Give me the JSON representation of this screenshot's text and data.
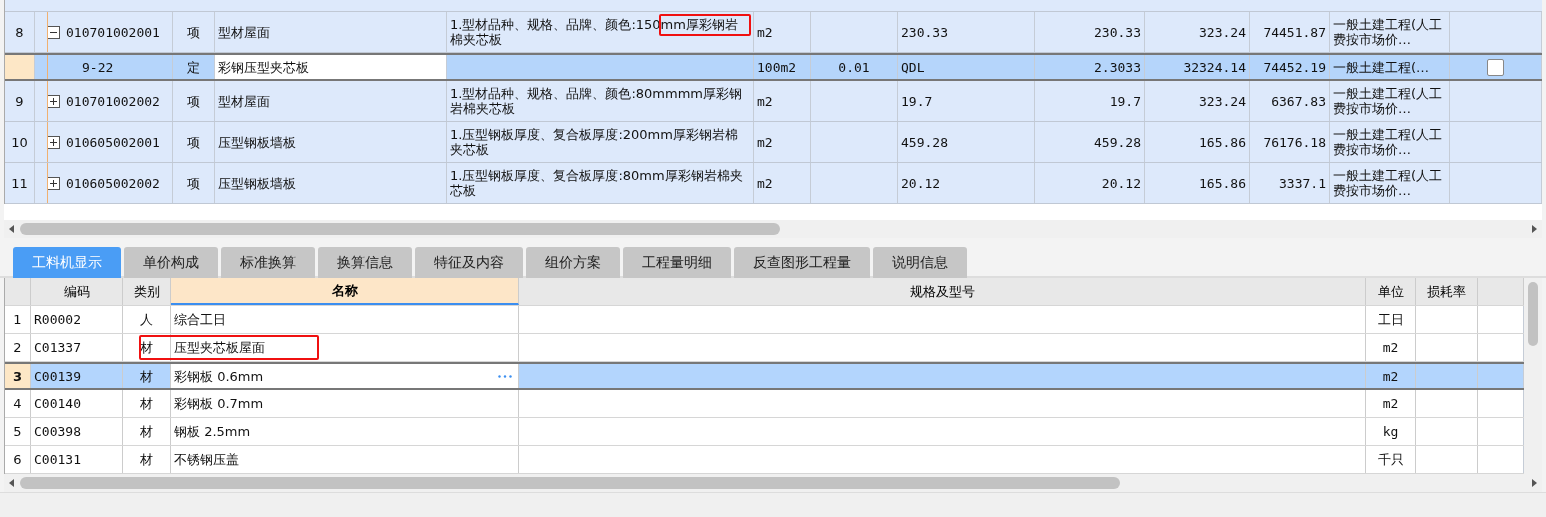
{
  "bill_rows": [
    {
      "kind": "item",
      "index": "8",
      "code": "010701002001",
      "expanded": true,
      "type": "项",
      "name": "型材屋面",
      "description": "1.型材品种、规格、品牌、颜色:150mm厚彩钢岩棉夹芯板",
      "marked": true,
      "unit": "m2",
      "column_7": "",
      "quantity_expression": "230.33",
      "quantity": "230.33",
      "unit_price": "323.24",
      "total": "74451.87",
      "fee_category": "一般土建工程(人工费按市场价…"
    },
    {
      "kind": "definition",
      "index": "",
      "code": "9-22",
      "type": "定",
      "name": "彩钢压型夹芯板",
      "description": "",
      "unit": "100m2",
      "column_7": "0.01",
      "quantity_expression": "QDL",
      "quantity": "2.3033",
      "unit_price": "32324.14",
      "total": "74452.19",
      "fee_category": "一般土建工程(…",
      "checked": false,
      "selected": true
    },
    {
      "kind": "item",
      "index": "9",
      "code": "010701002002",
      "expanded": false,
      "type": "项",
      "name": "型材屋面",
      "description": "1.型材品种、规格、品牌、颜色:80mmmm厚彩钢岩棉夹芯板",
      "marked": false,
      "unit": "m2",
      "column_7": "",
      "quantity_expression": "19.7",
      "quantity": "19.7",
      "unit_price": "323.24",
      "total": "6367.83",
      "fee_category": "一般土建工程(人工费按市场价…"
    },
    {
      "kind": "item",
      "index": "10",
      "code": "010605002001",
      "expanded": false,
      "type": "项",
      "name": "压型钢板墙板",
      "description": "1.压型钢板厚度、复合板厚度:200mm厚彩钢岩棉夹芯板",
      "marked": false,
      "unit": "m2",
      "column_7": "",
      "quantity_expression": "459.28",
      "quantity": "459.28",
      "unit_price": "165.86",
      "total": "76176.18",
      "fee_category": "一般土建工程(人工费按市场价…"
    },
    {
      "kind": "item",
      "index": "11",
      "code": "010605002002",
      "expanded": false,
      "type": "项",
      "name": "压型钢板墙板",
      "description": "1.压型钢板厚度、复合板厚度:80mm厚彩钢岩棉夹芯板",
      "marked": false,
      "unit": "m2",
      "column_7": "",
      "quantity_expression": "20.12",
      "quantity": "20.12",
      "unit_price": "165.86",
      "total": "3337.1",
      "fee_category": "一般土建工程(人工费按市场价…"
    }
  ],
  "tabs": [
    {
      "label": "工料机显示",
      "selected": true
    },
    {
      "label": "单价构成",
      "selected": false
    },
    {
      "label": "标准换算",
      "selected": false
    },
    {
      "label": "换算信息",
      "selected": false
    },
    {
      "label": "特征及内容",
      "selected": false
    },
    {
      "label": "组价方案",
      "selected": false
    },
    {
      "label": "工程量明细",
      "selected": false
    },
    {
      "label": "反查图形工程量",
      "selected": false
    },
    {
      "label": "说明信息",
      "selected": false
    }
  ],
  "resource_table": {
    "columns": [
      "编码",
      "类别",
      "名称",
      "规格及型号",
      "单位",
      "损耗率"
    ],
    "rows": [
      {
        "index": "1",
        "code": "R00002",
        "category": "人",
        "name": "综合工日",
        "spec": "",
        "unit": "工日",
        "selected": false,
        "marked": false
      },
      {
        "index": "2",
        "code": "C01337",
        "category": "材",
        "name": "压型夹芯板屋面",
        "spec": "",
        "unit": "m2",
        "selected": false,
        "marked": true
      },
      {
        "index": "3",
        "code": "C00139",
        "category": "材",
        "name": "彩钢板 0.6mm",
        "spec": "",
        "unit": "m2",
        "selected": true,
        "marked": false
      },
      {
        "index": "4",
        "code": "C00140",
        "category": "材",
        "name": "彩钢板 0.7mm",
        "spec": "",
        "unit": "m2",
        "selected": false,
        "marked": false
      },
      {
        "index": "5",
        "code": "C00398",
        "category": "材",
        "name": "钢板 2.5mm",
        "spec": "",
        "unit": "kg",
        "selected": false,
        "marked": false
      },
      {
        "index": "6",
        "code": "C00131",
        "category": "材",
        "name": "不锈钢压盖",
        "spec": "",
        "unit": "千只",
        "selected": false,
        "marked": false
      }
    ]
  }
}
